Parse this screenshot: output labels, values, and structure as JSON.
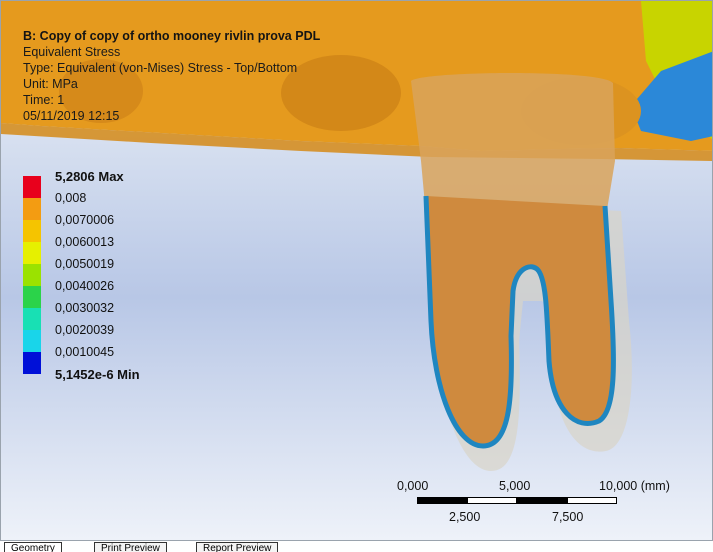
{
  "info": {
    "title": "B: Copy of copy of ortho mooney rivlin prova PDL",
    "result": "Equivalent Stress",
    "type": "Type: Equivalent (von-Mises) Stress - Top/Bottom",
    "unit": "Unit: MPa",
    "time": "Time: 1",
    "timestamp": "05/11/2019 12:15"
  },
  "legend": [
    {
      "label": "5,2806 Max",
      "color": "#e8001c",
      "bold": true
    },
    {
      "label": "0,008",
      "color": "#f39c12"
    },
    {
      "label": "0,0070006",
      "color": "#f5c400"
    },
    {
      "label": "0,0060013",
      "color": "#e6f000"
    },
    {
      "label": "0,0050019",
      "color": "#9be200"
    },
    {
      "label": "0,0040026",
      "color": "#2bd34a"
    },
    {
      "label": "0,0030032",
      "color": "#18e0b4"
    },
    {
      "label": "0,0020039",
      "color": "#19d5ea"
    },
    {
      "label": "0,0010045",
      "color": "#1a7fe8"
    },
    {
      "label": "5,1452e-6 Min",
      "color": "#0010d8",
      "bold": true
    }
  ],
  "scale": {
    "top_labels": [
      "0,000",
      "5,000",
      "10,000 (mm)"
    ],
    "bottom_labels": [
      "2,500",
      "7,500"
    ]
  },
  "tabs": [
    "Geometry",
    "Print Preview",
    "Report Preview"
  ]
}
